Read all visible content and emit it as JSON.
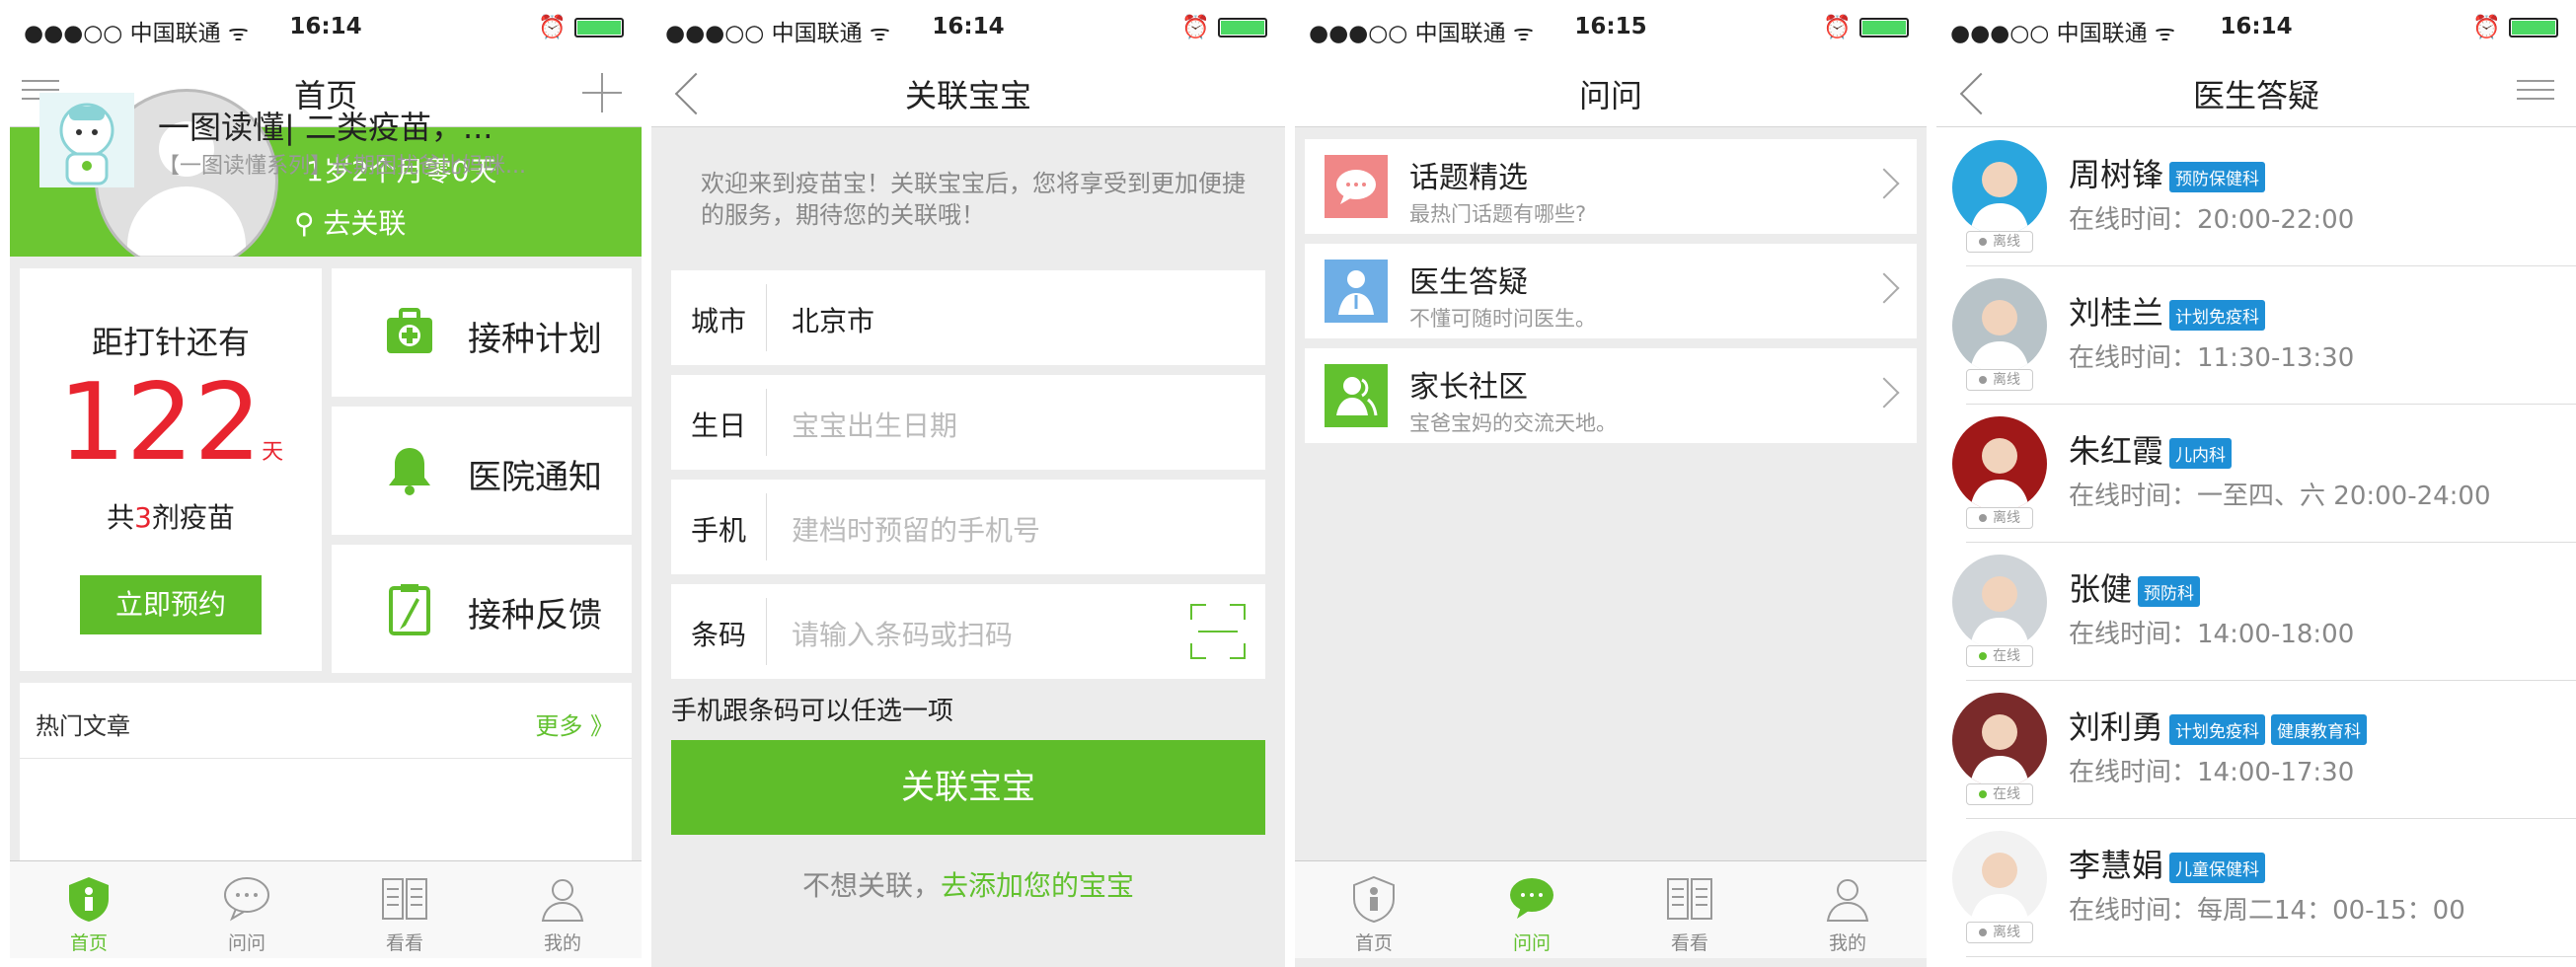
{
  "status": {
    "carrier": "●●●○○ 中国联通 ᯤ",
    "times": [
      "16:14",
      "16:14",
      "16:15",
      "16:14"
    ]
  },
  "colors": {
    "brand_green": "#62c12f",
    "red": "#e8242f",
    "tag_blue": "#1e8fd6"
  },
  "screen1": {
    "title": "首页",
    "age": "1岁2个月零0天",
    "link": "去关联",
    "countdown_label": "距打针还有",
    "countdown_value": "122",
    "countdown_unit": "天",
    "total_prefix": "共",
    "total_count": "3",
    "total_suffix": "剂疫苗",
    "book_button": "立即预约",
    "menu": [
      {
        "label": "接种计划",
        "icon": "medkit-icon"
      },
      {
        "label": "医院通知",
        "icon": "bell-icon"
      },
      {
        "label": "接种反馈",
        "icon": "clipboard-icon"
      }
    ],
    "articles_header": "热门文章",
    "more": "更多 》",
    "article": {
      "title": "一图读懂| 二类疫苗，...",
      "subtitle": "【一图读懂系列】长期困扰爸比妈咪..."
    }
  },
  "screen2": {
    "title": "关联宝宝",
    "intro": "欢迎来到疫苗宝！关联宝宝后，您将享受到更加便捷的服务，期待您的关联哦！",
    "fields": [
      {
        "key": "城市",
        "value": "北京市",
        "placeholder": ""
      },
      {
        "key": "生日",
        "value": "",
        "placeholder": "宝宝出生日期"
      },
      {
        "key": "手机",
        "value": "",
        "placeholder": "建档时预留的手机号"
      },
      {
        "key": "条码",
        "value": "",
        "placeholder": "请输入条码或扫码"
      }
    ],
    "tip": "手机跟条码可以任选一项",
    "button": "关联宝宝",
    "alt_prefix": "不想关联，",
    "alt_link": "去添加您的宝宝"
  },
  "screen3": {
    "title": "问问",
    "items": [
      {
        "title": "话题精选",
        "sub": "最热门话题有哪些?",
        "icon": "chat-bubble-icon",
        "color": "#f08787"
      },
      {
        "title": "医生答疑",
        "sub": "不懂可随时问医生。",
        "icon": "doctor-icon",
        "color": "#6eaee6"
      },
      {
        "title": "家长社区",
        "sub": "宝爸宝妈的交流天地。",
        "icon": "community-icon",
        "color": "#62c12f"
      }
    ]
  },
  "screen4": {
    "title": "医生答疑",
    "time_prefix": "在线时间：",
    "doctors": [
      {
        "name": "周树锋",
        "tags": [
          "预防保健科"
        ],
        "time": "20:00-22:00",
        "status": "离线"
      },
      {
        "name": "刘桂兰",
        "tags": [
          "计划免疫科"
        ],
        "time": "11:30-13:30",
        "status": "离线"
      },
      {
        "name": "朱红霞",
        "tags": [
          "儿内科"
        ],
        "time": "一至四、六 20:00-24:00",
        "status": "离线"
      },
      {
        "name": "张健",
        "tags": [
          "预防科"
        ],
        "time": "14:00-18:00",
        "status": "在线"
      },
      {
        "name": "刘利勇",
        "tags": [
          "计划免疫科",
          "健康教育科"
        ],
        "time": "14:00-17:30",
        "status": "在线"
      },
      {
        "name": "李慧娟",
        "tags": [
          "儿童保健科"
        ],
        "time": "每周二14：00-15：00",
        "status": "离线"
      }
    ]
  },
  "tabbar": {
    "labels": [
      "首页",
      "问问",
      "看看",
      "我的"
    ]
  }
}
